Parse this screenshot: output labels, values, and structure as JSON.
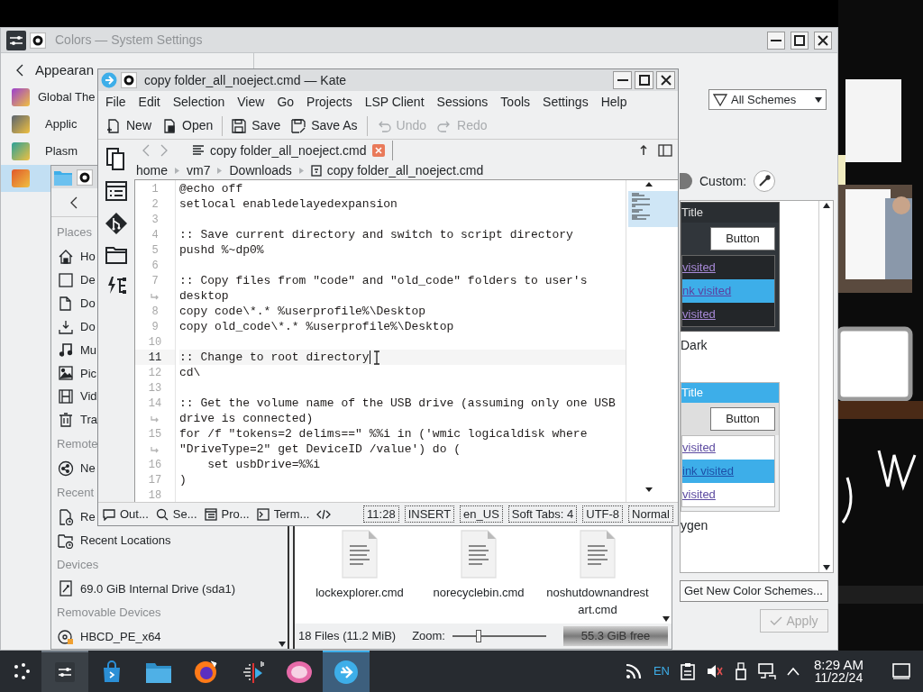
{
  "settings_window": {
    "title": "Colors — System Settings",
    "back_label": "Appearan",
    "nav_items": [
      {
        "label": "Global The",
        "kind": "theme",
        "selected": false
      },
      {
        "label": "Applic",
        "kind": "style",
        "selected": false
      },
      {
        "label": "Plasm",
        "kind": "plasma",
        "selected": false
      },
      {
        "kind": "colors",
        "selected": true
      }
    ],
    "filter": "All Schemes",
    "custom_label": "Custom:",
    "schemes": [
      {
        "kind": "dark",
        "title": "Title",
        "button": "Button",
        "links": [
          "visited",
          "nk visited",
          "visited"
        ],
        "name": "Dark"
      },
      {
        "kind": "light",
        "title": "Title",
        "button": "Button",
        "links": [
          "visited",
          "ink visited",
          "visited"
        ],
        "name": "ygen"
      }
    ],
    "get_new_button": "Get New Color Schemes...",
    "apply_button": {
      "label": "Apply",
      "disabled": true
    }
  },
  "file_manager": {
    "places": [
      {
        "heading": "Places",
        "items": [
          {
            "kind": "home",
            "label": "Ho"
          },
          {
            "kind": "desktop",
            "label": "De"
          },
          {
            "kind": "documents",
            "label": "Do"
          },
          {
            "kind": "downloads",
            "label": "Do"
          },
          {
            "kind": "music",
            "label": "Mu"
          },
          {
            "kind": "pictures",
            "label": "Pic"
          },
          {
            "kind": "videos",
            "label": "Vid"
          },
          {
            "kind": "trash",
            "label": "Tra"
          }
        ]
      },
      {
        "heading": "Remote",
        "items": [
          {
            "kind": "network",
            "label": "Ne"
          }
        ]
      },
      {
        "heading": "Recent",
        "items": [
          {
            "kind": "recent-files",
            "label": "Re"
          },
          {
            "kind": "recent-locations",
            "label": "Recent Locations"
          }
        ]
      },
      {
        "heading": "Devices",
        "items": [
          {
            "kind": "drive",
            "label": "69.0 GiB Internal Drive (sda1)"
          }
        ]
      },
      {
        "heading": "Removable Devices",
        "items": [
          {
            "kind": "usb",
            "label": "HBCD_PE_x64"
          }
        ]
      }
    ],
    "files": [
      "lockexplorer.cmd",
      "norecyclebin.cmd",
      "noshutdownandrestart.cmd"
    ],
    "status": "18 Files (11.2 MiB)",
    "zoom_label": "Zoom:",
    "zoom": {
      "level": 0.27
    },
    "free_space": "55.3 GiB free"
  },
  "editor_window": {
    "title": "copy folder_all_noeject.cmd — Kate",
    "menu": [
      "File",
      "Edit",
      "Selection",
      "View",
      "Go",
      "Projects",
      "LSP Client",
      "Sessions",
      "Tools",
      "Settings",
      "Help"
    ],
    "toolbar": [
      {
        "kind": "new",
        "label": "New",
        "disabled": false
      },
      {
        "kind": "open",
        "label": "Open",
        "disabled": false
      },
      {
        "kind": "save",
        "label": "Save",
        "disabled": false
      },
      {
        "kind": "save-as",
        "label": "Save As",
        "disabled": false
      },
      {
        "kind": "undo",
        "label": "Undo",
        "disabled": true
      },
      {
        "kind": "redo",
        "label": "Redo",
        "disabled": true
      }
    ],
    "tab": "copy folder_all_noeject.cmd",
    "breadcrumb": [
      "home",
      "vm7",
      "Downloads",
      "copy folder_all_noeject.cmd"
    ],
    "lines": [
      {
        "kind": "line",
        "number": "1",
        "text": "@echo off",
        "current": false
      },
      {
        "kind": "line",
        "number": "2",
        "text": "setlocal enabledelayedexpansion",
        "current": false
      },
      {
        "kind": "line",
        "number": "3",
        "current": false
      },
      {
        "kind": "line",
        "number": "4",
        "text": ":: Save current directory and switch to script directory",
        "current": false
      },
      {
        "kind": "line",
        "number": "5",
        "text": "pushd %~dp0%",
        "current": false
      },
      {
        "kind": "line",
        "number": "6",
        "current": false
      },
      {
        "kind": "line",
        "number": "7",
        "text": ":: Copy files from \"code\" and \"old_code\" folders to user's",
        "current": false
      },
      {
        "kind": "wrap",
        "text": "desktop",
        "current": false
      },
      {
        "kind": "line",
        "number": "8",
        "text": "copy code\\*.* %userprofile%\\Desktop",
        "current": false
      },
      {
        "kind": "line",
        "number": "9",
        "text": "copy old_code\\*.* %userprofile%\\Desktop",
        "current": false
      },
      {
        "kind": "line",
        "number": "10",
        "current": false
      },
      {
        "kind": "line",
        "number": "11",
        "text": ":: Change to root directory",
        "current": true
      },
      {
        "kind": "line",
        "number": "12",
        "text": "cd\\",
        "current": false
      },
      {
        "kind": "line",
        "number": "13",
        "current": false
      },
      {
        "kind": "line",
        "number": "14",
        "text": ":: Get the volume name of the USB drive (assuming only one USB",
        "current": false
      },
      {
        "kind": "wrap",
        "text": "drive is connected)",
        "current": false
      },
      {
        "kind": "line",
        "number": "15",
        "text": "for /f \"tokens=2 delims==\" %%i in ('wmic logicaldisk where",
        "current": false
      },
      {
        "kind": "wrap",
        "text": "\"DriveType=2\" get DeviceID /value') do (",
        "current": false
      },
      {
        "kind": "line",
        "number": "16",
        "text": "    set usbDrive=%%i",
        "current": false
      },
      {
        "kind": "line",
        "number": "17",
        "text": ")",
        "current": false
      },
      {
        "kind": "line",
        "number": "18",
        "current": false
      }
    ],
    "tool_tabs": [
      {
        "kind": "output",
        "label": "Out..."
      },
      {
        "kind": "search",
        "label": "Se..."
      },
      {
        "kind": "projects",
        "label": "Pro..."
      },
      {
        "kind": "terminal",
        "label": "Term..."
      },
      {
        "kind": "code"
      }
    ],
    "status_fields": [
      "11:28",
      "INSERT",
      "en_US",
      "Soft Tabs: 4",
      "UTF-8",
      "Normal"
    ]
  },
  "taskbar": {
    "apps": [
      {
        "kind": "sliders",
        "active": true
      },
      {
        "kind": "store",
        "active": false
      },
      {
        "kind": "files",
        "active": false
      },
      {
        "kind": "browser",
        "active": false
      },
      {
        "kind": "media",
        "active": false
      },
      {
        "kind": "pink",
        "active": false
      },
      {
        "kind": "kate",
        "active": true
      }
    ],
    "language": "EN",
    "time": "8:29 AM",
    "date": "11/22/24"
  }
}
